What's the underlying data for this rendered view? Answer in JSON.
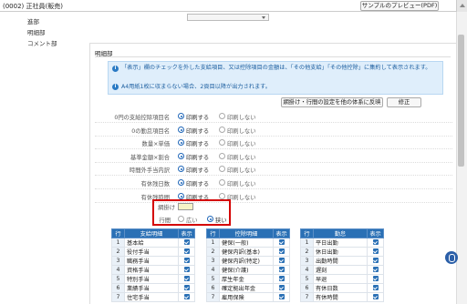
{
  "header": {
    "title": "(0002) 正社員(販売)",
    "preview_button": "サンプルのプレビュー(PDF)"
  },
  "nav": {
    "items": [
      "進部",
      "明細部",
      "コメント部"
    ]
  },
  "section": {
    "title": "明細部"
  },
  "info": {
    "line1": "「表示」欄のチェックを外した支給項目、又は控除項目の金額は、「その他支給」「その他控除」に集約して表示されます。",
    "line2": "A4用紙1枚に収まらない場合、2頁目以降が出力されます。",
    "icon1": "i",
    "icon2": "i"
  },
  "actions": {
    "reflect": "網掛け・行間の設定を他の体系に反映",
    "edit": "修正"
  },
  "print_options": {
    "on": "印刷する",
    "off": "印刷しない"
  },
  "settings": [
    {
      "label": "0円の支給控除項目名",
      "value": "印刷する"
    },
    {
      "label": "0の勤怠項目名",
      "value": "印刷する"
    },
    {
      "label": "数量×単価",
      "value": "印刷する"
    },
    {
      "label": "基準金額×割合",
      "value": "印刷する"
    },
    {
      "label": "時間外手当内訳",
      "value": "印刷する"
    },
    {
      "label": "有休残日数",
      "value": "印刷する"
    },
    {
      "label": "有休残時間",
      "value": "印刷する"
    }
  ],
  "highlight": {
    "shade_label": "網掛け",
    "spacing_label": "行間",
    "wide": "広い",
    "narrow": "狭い",
    "selected": "狭い",
    "shade_color": "#f6f4c8"
  },
  "tables": {
    "pay": {
      "headers": [
        "行",
        "支給明細",
        "表示"
      ],
      "rows": [
        {
          "no": "1",
          "name": "基本給"
        },
        {
          "no": "2",
          "name": "役付手当"
        },
        {
          "no": "3",
          "name": "職務手当"
        },
        {
          "no": "4",
          "name": "資格手当"
        },
        {
          "no": "5",
          "name": "特別手当"
        },
        {
          "no": "6",
          "name": "業績手当"
        },
        {
          "no": "7",
          "name": "住宅手当"
        }
      ]
    },
    "deduct": {
      "headers": [
        "行",
        "控除明細",
        "表示"
      ],
      "rows": [
        {
          "no": "1",
          "name": "健保(一般)"
        },
        {
          "no": "2",
          "name": "健保内訳(基本)"
        },
        {
          "no": "3",
          "name": "健保内訳(特定)"
        },
        {
          "no": "4",
          "name": "健保(介護)"
        },
        {
          "no": "5",
          "name": "厚生年金"
        },
        {
          "no": "6",
          "name": "確定拠出年金"
        },
        {
          "no": "7",
          "name": "雇用保険"
        }
      ]
    },
    "attend": {
      "headers": [
        "行",
        "勤怠",
        "表示"
      ],
      "rows": [
        {
          "no": "1",
          "name": "平日出勤"
        },
        {
          "no": "2",
          "name": "休日出勤"
        },
        {
          "no": "3",
          "name": "出勤時間"
        },
        {
          "no": "4",
          "name": "遅刻"
        },
        {
          "no": "5",
          "name": "早退"
        },
        {
          "no": "6",
          "name": "有休日数"
        },
        {
          "no": "7",
          "name": "有休時間"
        }
      ]
    }
  },
  "colors": {
    "accent": "#2a70b5",
    "highlight_border": "#d40000",
    "info_bg": "#dfeefb"
  }
}
